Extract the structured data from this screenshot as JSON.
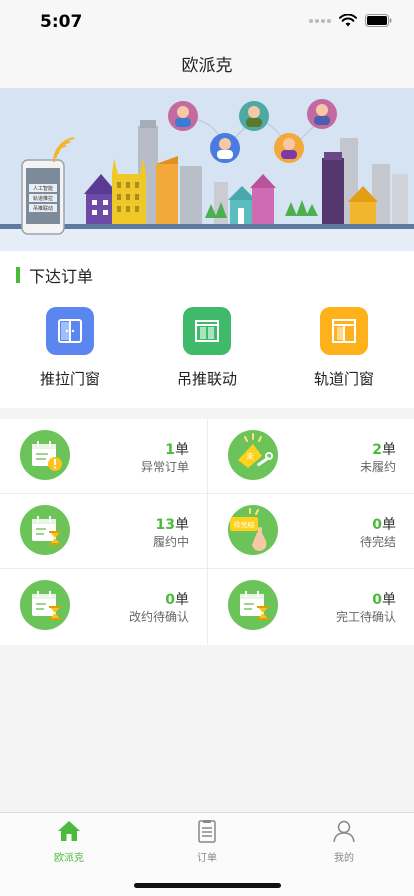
{
  "status": {
    "time": "5:07"
  },
  "nav": {
    "title": "欧派克"
  },
  "banner": {
    "phone_lines": [
      "人工智能",
      "轨道推拉",
      "吊推联动"
    ]
  },
  "order": {
    "title": "下达订单",
    "categories": [
      {
        "label": "推拉门窗",
        "color": "#5b86f0",
        "icon": "sliding-door-icon"
      },
      {
        "label": "吊推联动",
        "color": "#3fba6a",
        "icon": "hanging-door-icon"
      },
      {
        "label": "轨道门窗",
        "color": "#ffb11b",
        "icon": "track-window-icon"
      }
    ]
  },
  "stats": {
    "unit": "单",
    "items": [
      {
        "count": "1",
        "label": "异常订单",
        "icon": "calendar-alert-icon"
      },
      {
        "count": "2",
        "label": "未履约",
        "icon": "tag-wrench-icon",
        "tag": "未"
      },
      {
        "count": "13",
        "label": "履约中",
        "icon": "calendar-hourglass-icon"
      },
      {
        "count": "0",
        "label": "待完结",
        "icon": "pending-tag-icon",
        "tag": "待完结"
      },
      {
        "count": "0",
        "label": "改约待确认",
        "icon": "calendar-hourglass-icon"
      },
      {
        "count": "0",
        "label": "完工待确认",
        "icon": "calendar-hourglass-icon"
      }
    ]
  },
  "tabs": [
    {
      "label": "欧派克",
      "active": true
    },
    {
      "label": "订单",
      "active": false
    },
    {
      "label": "我的",
      "active": false
    }
  ],
  "colors": {
    "accent": "#4cba3d",
    "stat_icon_bg": "#6cc35a"
  }
}
